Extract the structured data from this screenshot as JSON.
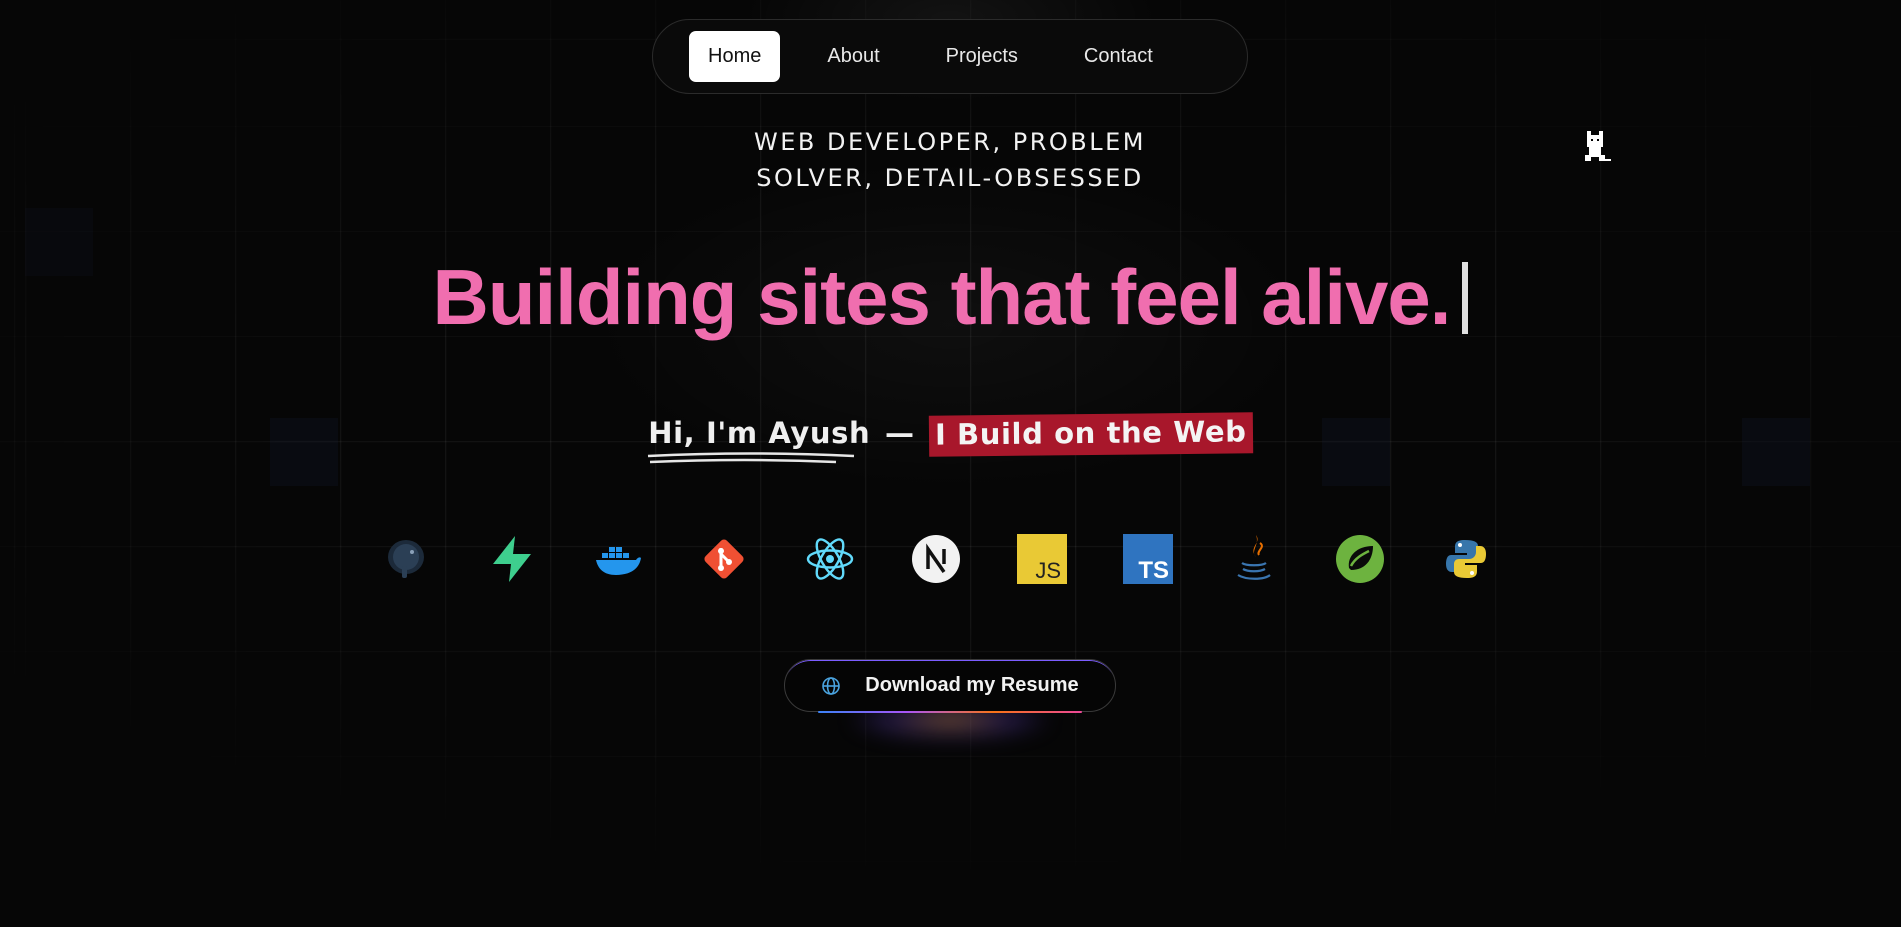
{
  "nav": {
    "items": [
      {
        "label": "Home",
        "active": true
      },
      {
        "label": "About",
        "active": false
      },
      {
        "label": "Projects",
        "active": false
      },
      {
        "label": "Contact",
        "active": false
      }
    ]
  },
  "hero": {
    "subtitle": "WEB DEVELOPER, PROBLEM\nSOLVER, DETAIL-OBSESSED",
    "headline": "Building sites that feel alive.",
    "intro_name": "Hi, I'm Ayush",
    "intro_dash": "—",
    "intro_highlight": "I Build on the Web"
  },
  "tech_stack": [
    {
      "icon": "postgresql-icon"
    },
    {
      "icon": "supabase-icon"
    },
    {
      "icon": "docker-icon"
    },
    {
      "icon": "git-icon"
    },
    {
      "icon": "react-icon"
    },
    {
      "icon": "nextjs-icon"
    },
    {
      "icon": "javascript-icon"
    },
    {
      "icon": "typescript-icon"
    },
    {
      "icon": "java-icon"
    },
    {
      "icon": "spring-icon"
    },
    {
      "icon": "python-icon"
    }
  ],
  "resume_button": {
    "label": "Download my Resume",
    "icon": "globe-icon"
  },
  "colors": {
    "background": "#060606",
    "headline": "#f06eaf",
    "highlight": "#a8172b"
  }
}
